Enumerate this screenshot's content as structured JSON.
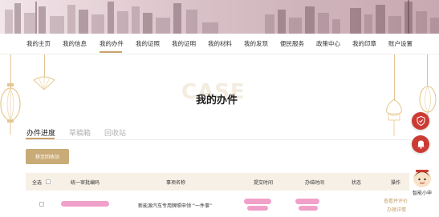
{
  "nav": {
    "items": [
      "我的主页",
      "我的信息",
      "我的办件",
      "我的证照",
      "我的证明",
      "我的材料",
      "我的发现",
      "便民服务",
      "政策中心",
      "我的印章",
      "账户设置"
    ],
    "active_index": 2
  },
  "page": {
    "watermark": "CASE",
    "title": "我的办件"
  },
  "tabs": [
    "办件进度",
    "草稿箱",
    "回收站"
  ],
  "active_tab": 0,
  "toolbar": {
    "recycle_button": "移至回收站"
  },
  "table": {
    "headers": [
      "全选",
      "统一审批编码",
      "事项名称",
      "提交时间",
      "办结时间",
      "状态",
      "操作"
    ],
    "rows": [
      {
        "item_name": "新能源汽车专用牌照申领 “一件事”",
        "actions": [
          "查看并评价",
          "办理详情"
        ]
      }
    ]
  },
  "assistant": {
    "label": "智能小申"
  },
  "colors": {
    "accent": "#c6a16b",
    "button": "#c9ab78",
    "float_red": "#cc3b33",
    "table_header": "#f7f0e6"
  },
  "icons": [
    "lantern-icon",
    "folding-fan-icon",
    "knot-ornament-icon",
    "shield-icon",
    "bell-icon",
    "assistant-avatar-icon"
  ]
}
